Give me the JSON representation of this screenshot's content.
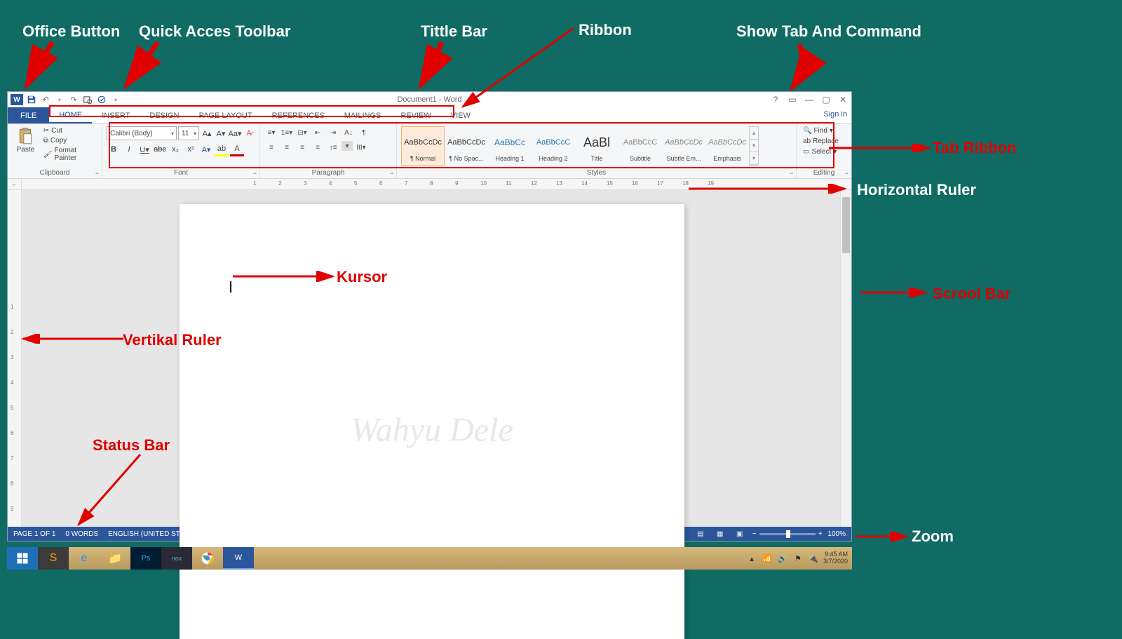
{
  "titlebar": {
    "title": "Document1 - Word"
  },
  "window_controls": {
    "help": "?",
    "ribbon_opts": "▭",
    "min": "—",
    "restore": "▢",
    "close": "✕"
  },
  "tabs": {
    "file": "FILE",
    "home": "HOME",
    "insert": "INSERT",
    "design": "DESIGN",
    "page_layout": "PAGE LAYOUT",
    "references": "REFERENCES",
    "mailings": "MAILINGS",
    "review": "REVIEW",
    "view": "VIEW",
    "signin": "Sign in"
  },
  "clipboard": {
    "paste": "Paste",
    "cut": "Cut",
    "copy": "Copy",
    "format_painter": "Format Painter",
    "label": "Clipboard"
  },
  "font": {
    "name": "Calibri (Body)",
    "size": "11",
    "label": "Font"
  },
  "paragraph": {
    "label": "Paragraph"
  },
  "styles": {
    "label": "Styles",
    "items": [
      {
        "preview": "AaBbCcDc",
        "name": "¶ Normal",
        "cls": ""
      },
      {
        "preview": "AaBbCcDc",
        "name": "¶ No Spac...",
        "cls": ""
      },
      {
        "preview": "AaBbCc",
        "name": "Heading 1",
        "cls": "h1"
      },
      {
        "preview": "AaBbCcC",
        "name": "Heading 2",
        "cls": "h2"
      },
      {
        "preview": "AaBl",
        "name": "Title",
        "cls": "title"
      },
      {
        "preview": "AaBbCcC",
        "name": "Subtitle",
        "cls": "subtitle"
      },
      {
        "preview": "AaBbCcDc",
        "name": "Subtle Em...",
        "cls": "emph"
      },
      {
        "preview": "AaBbCcDc",
        "name": "Emphasis",
        "cls": "emph"
      }
    ]
  },
  "editing": {
    "find": "Find",
    "replace": "Replace",
    "select": "Select",
    "label": "Editing"
  },
  "status": {
    "page": "PAGE 1 OF 1",
    "words": "0 WORDS",
    "lang": "ENGLISH (UNITED STATES)",
    "zoom": "100%"
  },
  "taskbar": {
    "time": "9:45 AM",
    "date": "3/7/2020"
  },
  "watermark": "Wahyu Dele",
  "annotations": {
    "office_button": "Office Button",
    "quick_access": "Quick Acces Toolbar",
    "title_bar": "Tittle Bar",
    "ribbon": "Ribbon",
    "show_tab": "Show Tab And Command",
    "tab_ribbon": "Tab Ribbon",
    "horizontal_ruler": "Horizontal Ruler",
    "kursor": "Kursor",
    "scroll_bar": "Scrool Bar",
    "vertikal_ruler": "Vertikal Ruler",
    "status_bar": "Status Bar",
    "zoom": "Zoom"
  }
}
